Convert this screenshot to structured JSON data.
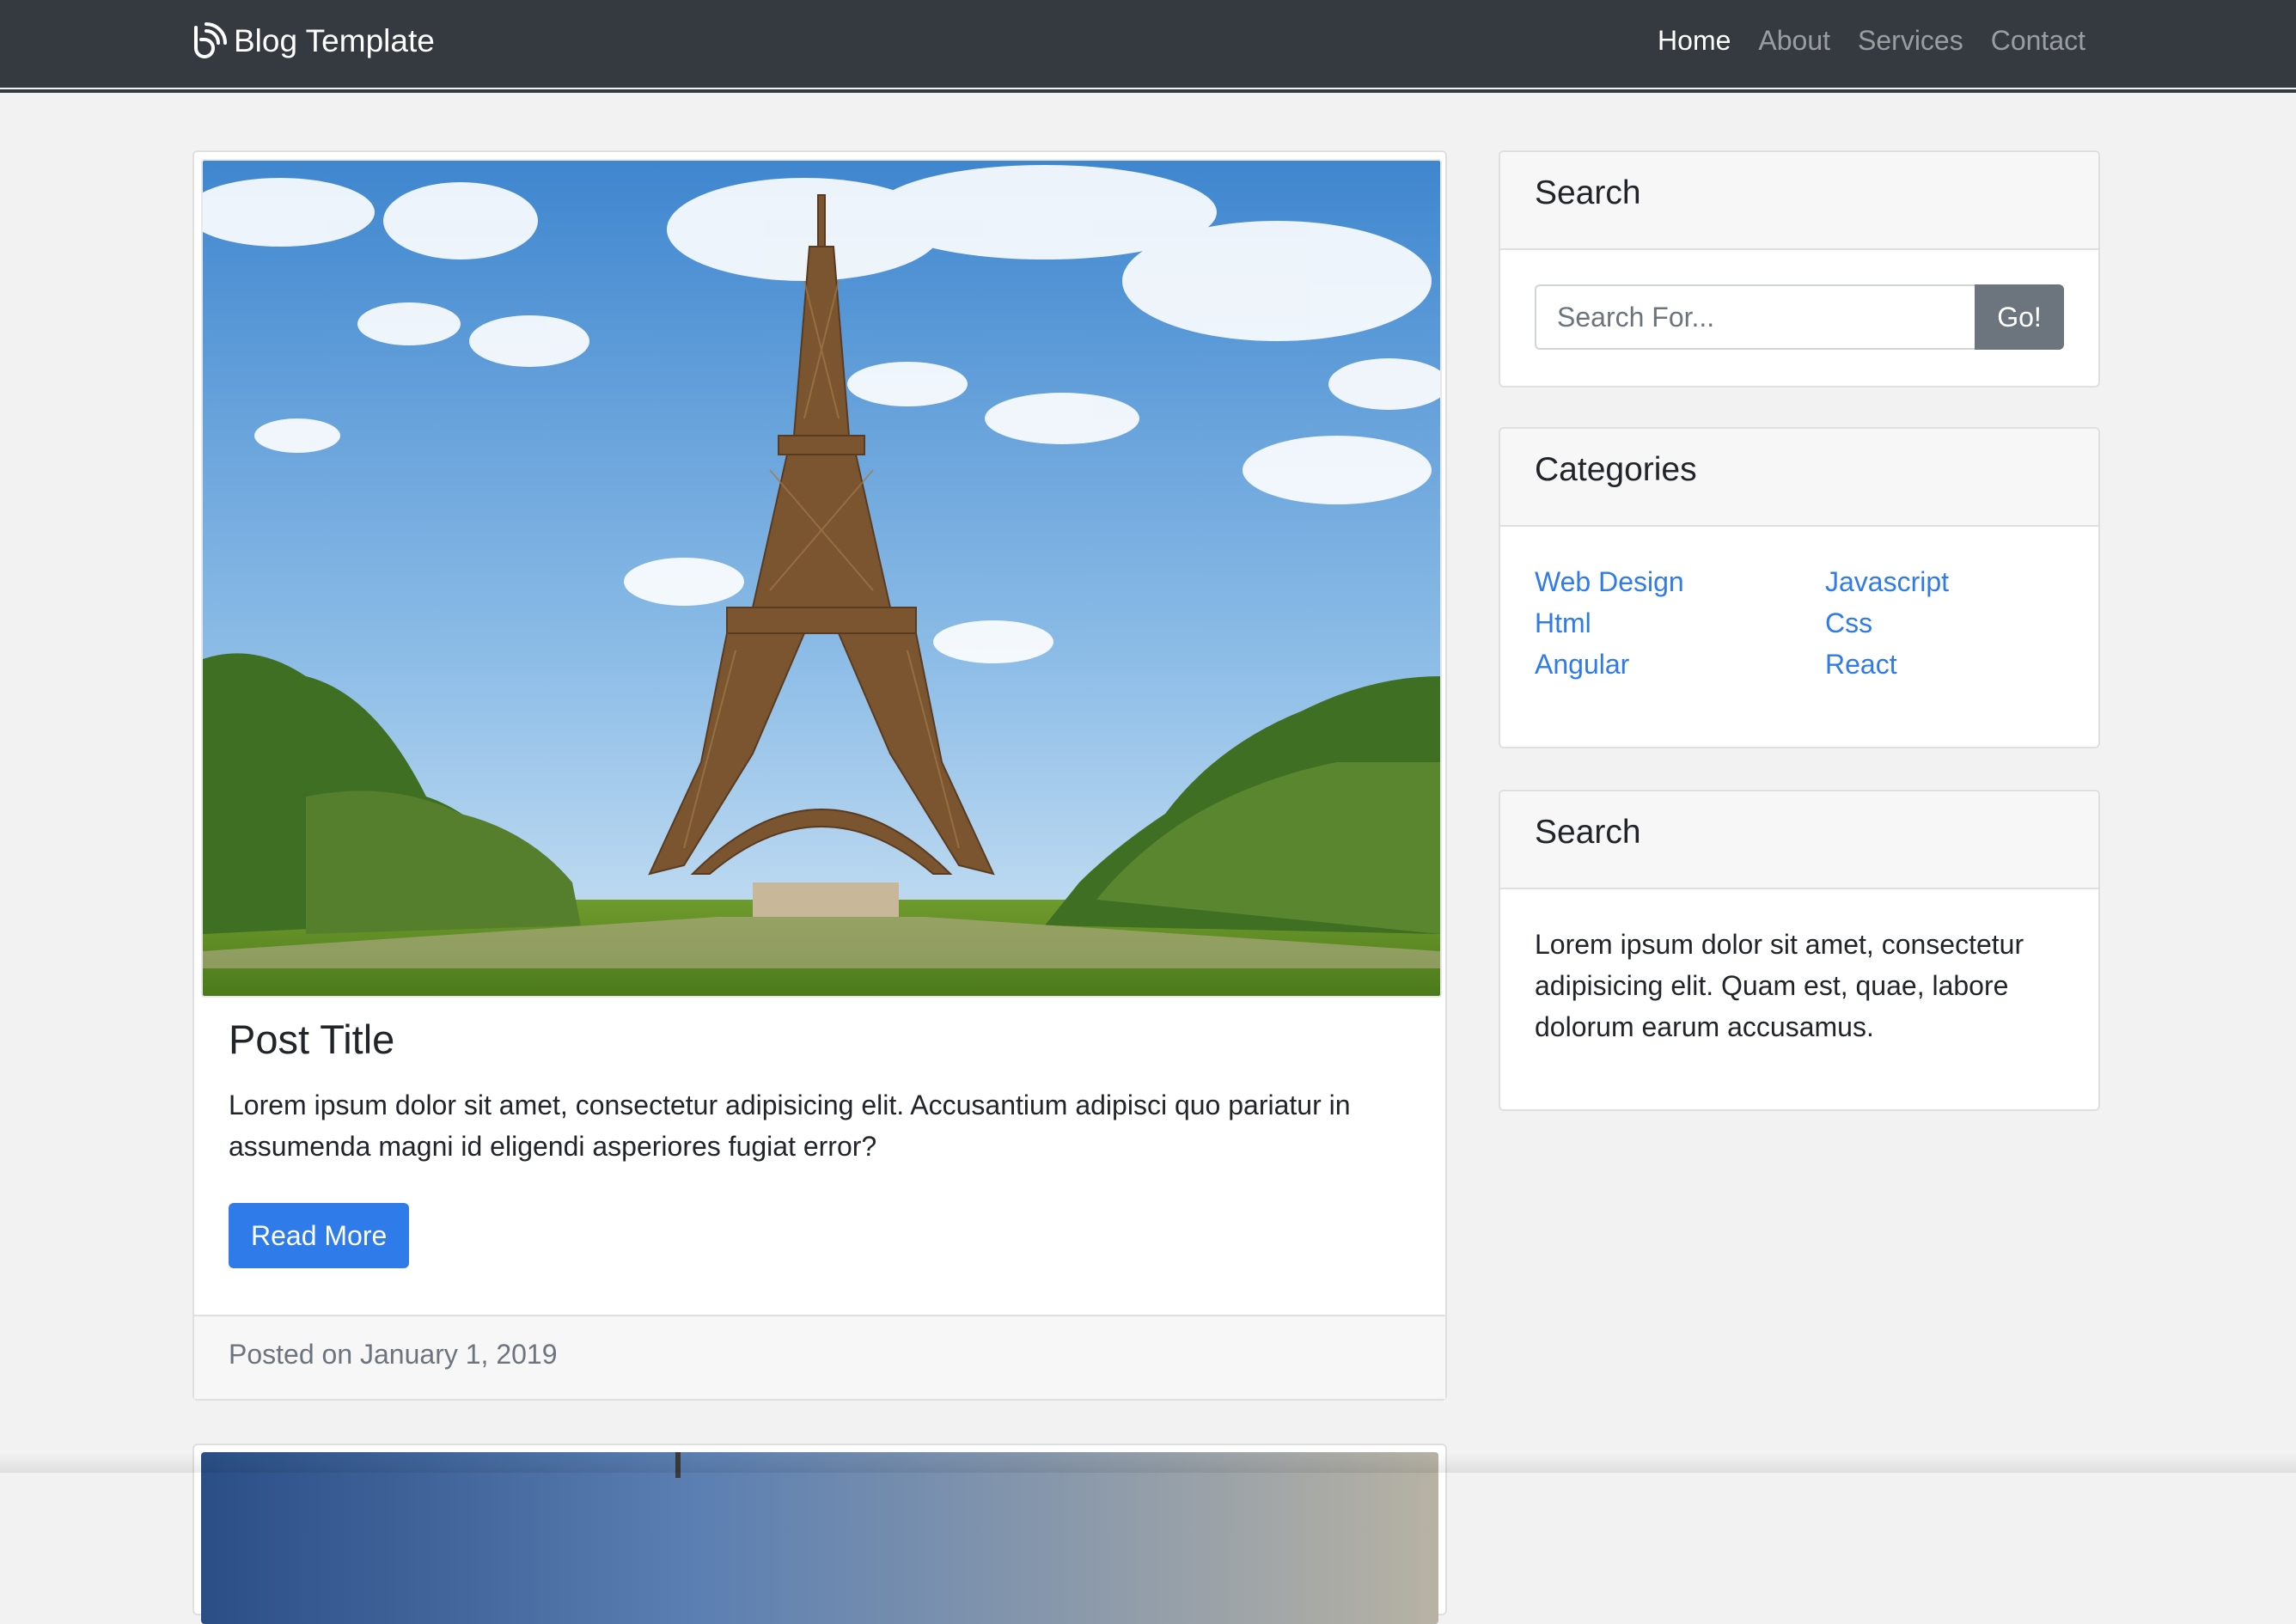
{
  "navbar": {
    "brand_text": "Blog Template",
    "brand_icon": "blog-logo-icon",
    "links": [
      {
        "label": "Home",
        "active": true
      },
      {
        "label": "About",
        "active": false
      },
      {
        "label": "Services",
        "active": false
      },
      {
        "label": "Contact",
        "active": false
      }
    ]
  },
  "post": {
    "title": "Post Title",
    "text": "Lorem ipsum dolor sit amet, consectetur adipisicing elit. Accusantium adipisci quo pariatur in assumenda magni id eligendi asperiores fugiat error?",
    "button_label": "Read More",
    "date": "Posted on January 1, 2019",
    "image": "eiffel-tower-photo"
  },
  "sidebar": {
    "search": {
      "title": "Search",
      "placeholder": "Search For...",
      "button_label": "Go!"
    },
    "categories": {
      "title": "Categories",
      "items": [
        "Web Design",
        "Javascript",
        "Html",
        "Css",
        "Angular",
        "React"
      ]
    },
    "widget": {
      "title": "Search",
      "text": "Lorem ipsum dolor sit amet, consectetur adipisicing elit. Quam est, quae, labore dolorum earum accusamus."
    }
  },
  "colors": {
    "navbar_bg": "#343a40",
    "primary": "#2f7bea",
    "secondary": "#6c757d",
    "page_bg": "#f2f2f2"
  }
}
